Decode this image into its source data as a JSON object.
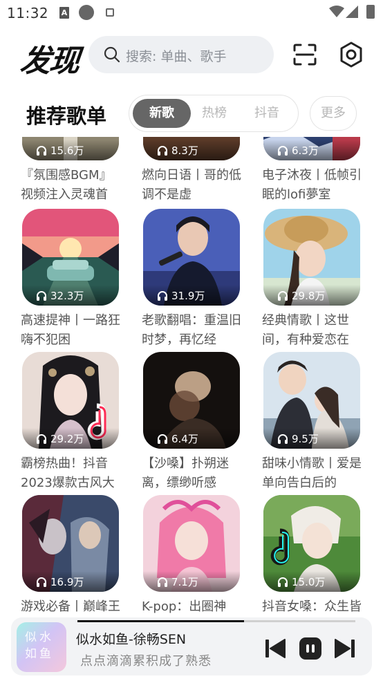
{
  "status_bar": {
    "time": "11:32",
    "a_icon_letter": "A"
  },
  "header": {
    "title": "发现",
    "search_placeholder": "搜索: 单曲、歌手"
  },
  "section": {
    "title": "推荐歌单",
    "tabs": [
      {
        "label": "新歌",
        "active": true
      },
      {
        "label": "热榜",
        "active": false
      },
      {
        "label": "抖音",
        "active": false
      }
    ],
    "more_label": "更多"
  },
  "playlists": [
    {
      "plays": "15.6万",
      "title": "『氛围感BGM』视频注入灵魂首"
    },
    {
      "plays": "8.3万",
      "title": "燃向日语丨哥的低调不是虚"
    },
    {
      "plays": "6.3万",
      "title": "电子沐夜丨低帧引眠的lofi夢室"
    },
    {
      "plays": "32.3万",
      "title": "高速提神丨一路狂嗨不犯困"
    },
    {
      "plays": "31.9万",
      "title": "老歌翻唱：重温旧时梦，再忆经"
    },
    {
      "plays": "29.8万",
      "title": "经典情歌丨这世间，有种爱恋在"
    },
    {
      "plays": "29.2万",
      "title": "霸榜热曲！抖音2023爆款古风大"
    },
    {
      "plays": "6.4万",
      "title": "【沙嗓】扑朔迷离，缥缈听感"
    },
    {
      "plays": "9.5万",
      "title": "甜味小情歌丨爱是单向告白后的"
    },
    {
      "plays": "16.9万",
      "title": "游戏必备丨巅峰王男，攻击力增"
    },
    {
      "plays": "7.1万",
      "title": "K-pop：出圈神曲，心动探测"
    },
    {
      "plays": "15.0万",
      "title": "抖音女嗓：众生皆无意，而你胜"
    }
  ],
  "player": {
    "song": "似水如鱼-徐畅SEN",
    "lyric": "点点滴滴累积成了熟悉",
    "cover_text": "似水如鱼",
    "progress": 0.6
  },
  "colors": {
    "active_tab": "#666666",
    "search_bg": "#eef0f3",
    "player_bg": "#f2f3f5"
  }
}
